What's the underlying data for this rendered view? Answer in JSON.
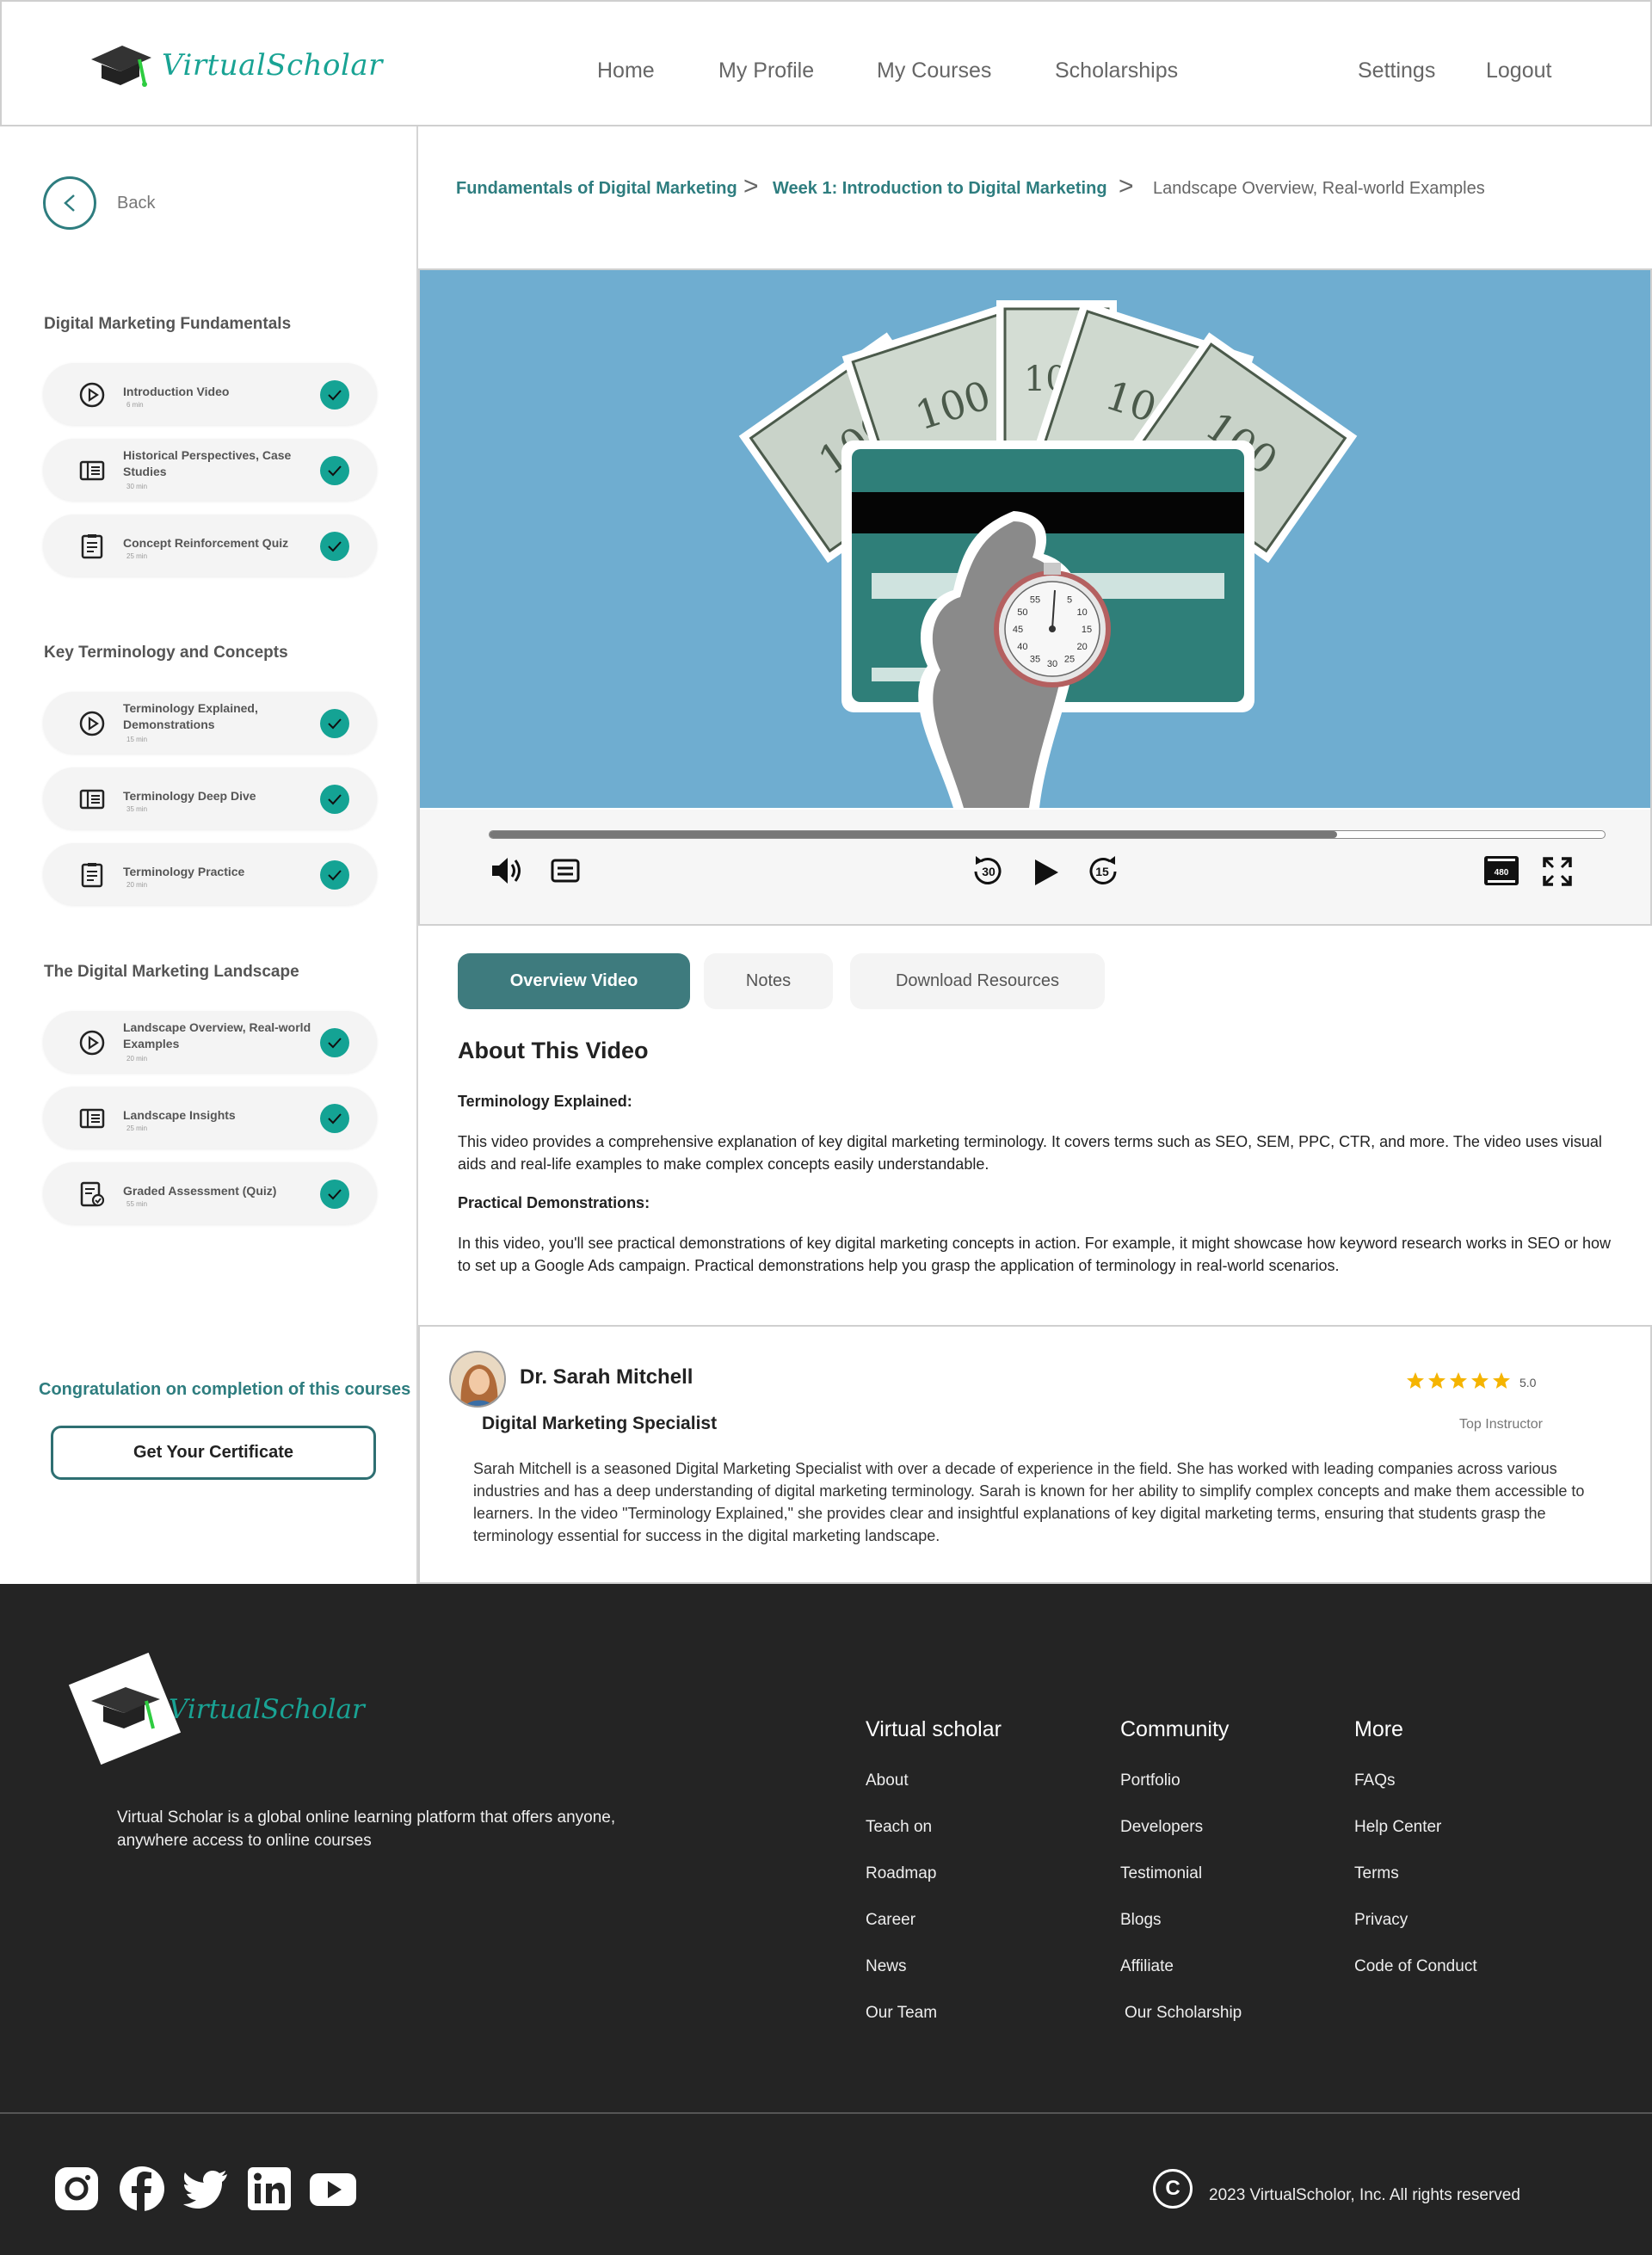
{
  "header": {
    "brand": "VirtualScholar",
    "nav": {
      "home": "Home",
      "profile": "My Profile",
      "courses": "My Courses",
      "scholarships": "Scholarships",
      "settings": "Settings",
      "logout": "Logout"
    }
  },
  "sidebar": {
    "back_label": "Back",
    "sections": [
      {
        "title": "Digital Marketing Fundamentals",
        "lessons": [
          {
            "title": "Introduction Video",
            "duration": "6 min",
            "icon": "play-circle-icon",
            "completed": true
          },
          {
            "title": "Historical Perspectives, Case Studies",
            "duration": "30 min",
            "icon": "reading-icon",
            "completed": true
          },
          {
            "title": "Concept Reinforcement Quiz",
            "duration": "25 min",
            "icon": "quiz-icon",
            "completed": true
          }
        ]
      },
      {
        "title": "Key Terminology and Concepts",
        "lessons": [
          {
            "title": "Terminology Explained, Demonstrations",
            "duration": "15 min",
            "icon": "play-circle-icon",
            "completed": true
          },
          {
            "title": "Terminology Deep Dive",
            "duration": "35 min",
            "icon": "reading-icon",
            "completed": true
          },
          {
            "title": "Terminology Practice",
            "duration": "20 min",
            "icon": "quiz-icon",
            "completed": true
          }
        ]
      },
      {
        "title": "The Digital Marketing Landscape",
        "lessons": [
          {
            "title": "Landscape Overview, Real-world Examples",
            "duration": "20 min",
            "icon": "play-circle-icon",
            "completed": true
          },
          {
            "title": "Landscape Insights",
            "duration": "25 min",
            "icon": "reading-icon",
            "completed": true
          },
          {
            "title": "Graded Assessment (Quiz)",
            "duration": "55 min",
            "icon": "graded-quiz-icon",
            "completed": true
          }
        ]
      }
    ],
    "congrats": "Congratulation on completion of this courses",
    "certificate_button": "Get Your Certificate"
  },
  "breadcrumb": {
    "course": "Fundamentals of Digital Marketing",
    "week": "Week 1: Introduction to Digital Marketing",
    "lesson": "Landscape Overview, Real-world Examples",
    "separator": ">"
  },
  "player": {
    "progress": 0.76,
    "rewind_seconds": "30",
    "forward_seconds": "15",
    "quality_badge": "480",
    "clock_numbers": [
      "5",
      "10",
      "15",
      "20",
      "25",
      "30",
      "35",
      "40",
      "45",
      "50",
      "55"
    ],
    "icons": [
      "volume-icon",
      "captions-icon",
      "rewind-30-icon",
      "play-icon",
      "forward-15-icon",
      "quality-icon",
      "fullscreen-icon"
    ]
  },
  "tabs": {
    "overview": "Overview Video",
    "notes": "Notes",
    "resources": "Download Resources",
    "active": "overview"
  },
  "about": {
    "title": "About This Video",
    "h1": "Terminology Explained:",
    "p1": "This video provides a comprehensive explanation of key digital marketing terminology. It covers terms such as SEO, SEM, PPC, CTR, and more. The video uses visual aids and real-life examples to make complex concepts easily understandable.",
    "h2": "Practical Demonstrations:",
    "p2": "In this video, you'll see practical demonstrations of key digital marketing concepts in action. For example, it might showcase how keyword research works in SEO or how to set up a Google Ads campaign. Practical demonstrations help you grasp the application of terminology in real-world scenarios."
  },
  "instructor": {
    "name": "Dr. Sarah Mitchell",
    "role": "Digital Marketing Specialist",
    "rating": "5.0",
    "stars": 5,
    "badge": "Top Instructor",
    "bio": "Sarah Mitchell is a seasoned Digital Marketing Specialist with over a decade of experience in the field. She has worked with leading companies across various industries and has a deep understanding of digital marketing terminology. Sarah is known for her ability to simplify complex concepts and make them accessible to learners. In the video \"Terminology Explained,\" she provides clear and insightful explanations of key digital marketing terms, ensuring that students grasp the terminology essential for success in the digital marketing landscape."
  },
  "footer": {
    "brand": "VirtualScholar",
    "description": "Virtual Scholar is a global online learning platform that offers anyone, anywhere access to online courses",
    "columns": [
      {
        "title": "Virtual scholar",
        "links": [
          "About",
          "Teach on",
          "Roadmap",
          "Career",
          "News",
          "Our Team"
        ]
      },
      {
        "title": "Community",
        "links": [
          "Portfolio",
          "Developers",
          "Testimonial",
          "Blogs",
          "Affiliate",
          "Our Scholarship"
        ]
      },
      {
        "title": "More",
        "links": [
          "FAQs",
          "Help Center",
          "Terms",
          "Privacy",
          "Code of Conduct"
        ]
      }
    ],
    "social": [
      "instagram-icon",
      "facebook-icon",
      "twitter-icon",
      "linkedin-icon",
      "youtube-icon"
    ],
    "copyright_symbol": "C",
    "copyright": "2023 VirtualScholor, Inc. All rights reserved"
  },
  "colors": {
    "accent": "#2e7d7f",
    "check": "#14a394",
    "video_bg": "#6fadd0",
    "footer_bg": "#242424"
  }
}
